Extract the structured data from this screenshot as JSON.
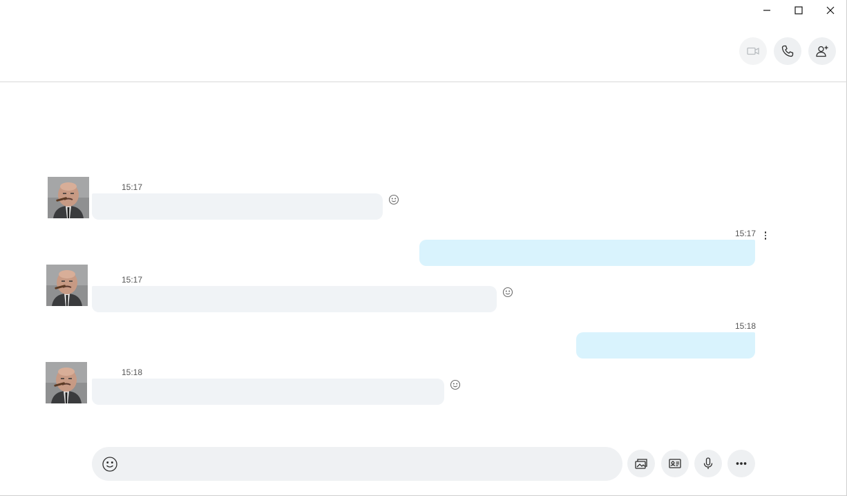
{
  "window": {
    "controls": [
      "minimize",
      "maximize",
      "close"
    ]
  },
  "header": {
    "buttons": [
      {
        "icon": "video-call-icon",
        "enabled": false
      },
      {
        "icon": "phone-icon",
        "enabled": true
      },
      {
        "icon": "add-person-icon",
        "enabled": true
      }
    ]
  },
  "messages": [
    {
      "direction": "incoming",
      "time": "15:17",
      "text": ""
    },
    {
      "direction": "outgoing",
      "time": "15:17",
      "text": ""
    },
    {
      "direction": "incoming",
      "time": "15:17",
      "text": ""
    },
    {
      "direction": "outgoing",
      "time": "15:18",
      "text": ""
    },
    {
      "direction": "incoming",
      "time": "15:18",
      "text": ""
    }
  ],
  "composer": {
    "placeholder": "",
    "value": ""
  },
  "colors": {
    "incoming_bubble": "#f0f3f6",
    "outgoing_bubble": "#d9f3fd",
    "button_bg": "#eef0f2"
  }
}
